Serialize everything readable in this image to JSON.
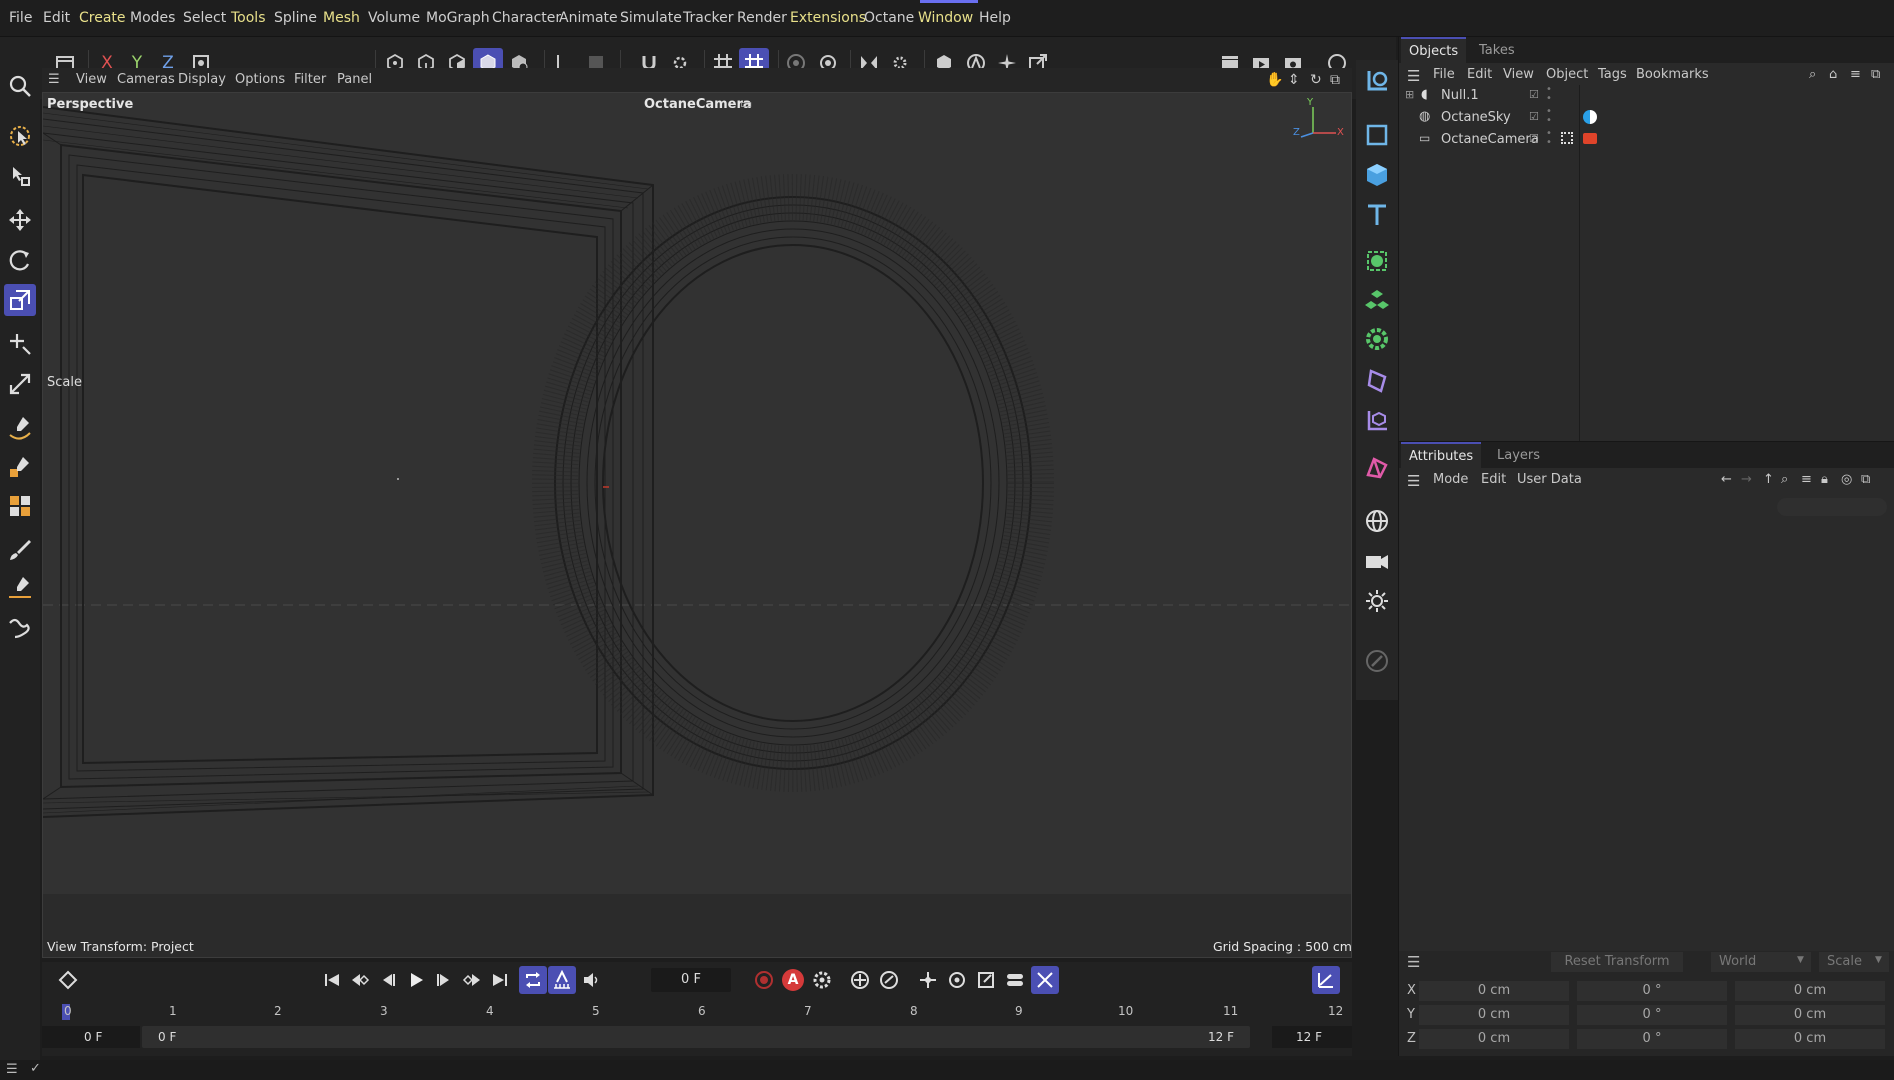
{
  "menu": {
    "items": [
      {
        "label": "File",
        "accent": false
      },
      {
        "label": "Edit",
        "accent": false
      },
      {
        "label": "Create",
        "accent": true
      },
      {
        "label": "Modes",
        "accent": false
      },
      {
        "label": "Select",
        "accent": false
      },
      {
        "label": "Tools",
        "accent": true
      },
      {
        "label": "Spline",
        "accent": false
      },
      {
        "label": "Mesh",
        "accent": true
      },
      {
        "label": "Volume",
        "accent": false
      },
      {
        "label": "MoGraph",
        "accent": false
      },
      {
        "label": "Character",
        "accent": false
      },
      {
        "label": "Animate",
        "accent": false
      },
      {
        "label": "Simulate",
        "accent": false
      },
      {
        "label": "Tracker",
        "accent": false
      },
      {
        "label": "Render",
        "accent": false
      },
      {
        "label": "Extensions",
        "accent": true
      },
      {
        "label": "Octane",
        "accent": false
      },
      {
        "label": "Window",
        "accent": true
      },
      {
        "label": "Help",
        "accent": false
      }
    ]
  },
  "toolbar": {
    "axis_x": "X",
    "axis_y": "Y",
    "axis_z": "Z"
  },
  "viewport": {
    "menu": [
      "View",
      "Cameras",
      "Display",
      "Options",
      "Filter",
      "Panel"
    ],
    "name": "Perspective",
    "camera": "OctaneCamera",
    "tool_label": "Scale",
    "view_transform": "View Transform: Project",
    "grid_spacing": "Grid Spacing : 500 cm",
    "axis_y": "Y",
    "axis_x": "X",
    "axis_z": "Z"
  },
  "objects_panel": {
    "tabs": [
      "Objects",
      "Takes"
    ],
    "menu": [
      "File",
      "Edit",
      "View",
      "Object",
      "Tags",
      "Bookmarks"
    ],
    "items": [
      {
        "name": "Null.1",
        "icon": "null-icon"
      },
      {
        "name": "OctaneSky",
        "icon": "sky-icon"
      },
      {
        "name": "OctaneCamera",
        "icon": "camera-icon"
      }
    ]
  },
  "attributes_panel": {
    "tabs": [
      "Attributes",
      "Layers"
    ],
    "menu": [
      "Mode",
      "Edit",
      "User Data"
    ]
  },
  "coordinates": {
    "reset_label": "Reset Transform",
    "space": "World",
    "mode": "Scale",
    "rows": [
      {
        "axis": "X",
        "pos": "0 cm",
        "rot": "0 °",
        "scale": "0 cm"
      },
      {
        "axis": "Y",
        "pos": "0 cm",
        "rot": "0 °",
        "scale": "0 cm"
      },
      {
        "axis": "Z",
        "pos": "0 cm",
        "rot": "0 °",
        "scale": "0 cm"
      }
    ]
  },
  "timeline": {
    "current_frame": "0 F",
    "ticks": [
      "0",
      "1",
      "2",
      "3",
      "4",
      "5",
      "6",
      "7",
      "8",
      "9",
      "10",
      "11",
      "12"
    ],
    "start": "0 F",
    "range_start": "0 F",
    "range_end": "12 F",
    "end": "12 F",
    "record_label": "A"
  },
  "colors": {
    "accent": "#4b4fb3",
    "menu_accent": "#e8e08a",
    "sky_tag": "#2aa0e8",
    "camera_tag": "#e0442a",
    "icon_blue": "#6fb6e8",
    "icon_green": "#58c66a"
  }
}
